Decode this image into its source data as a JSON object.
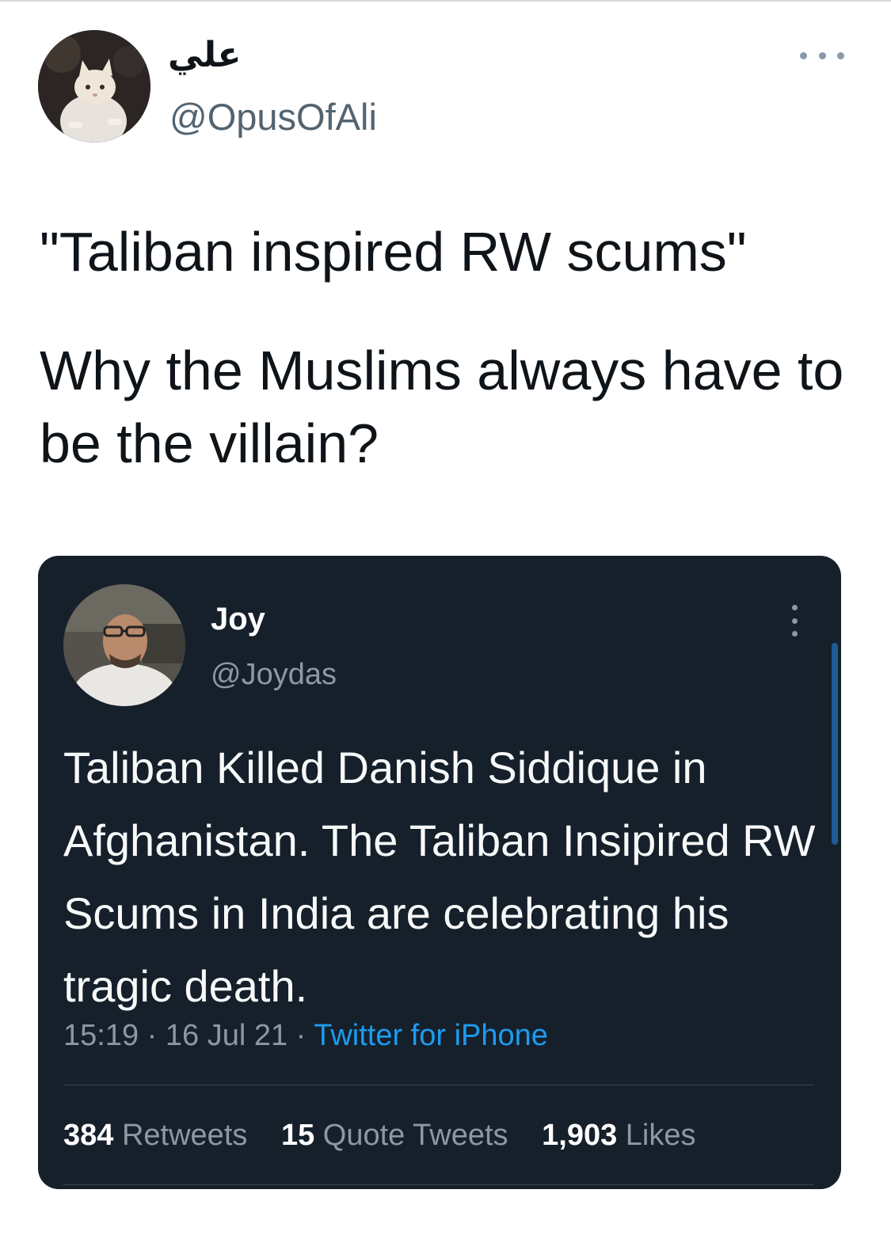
{
  "tweet": {
    "author": {
      "display_name": "علي",
      "handle": "@OpusOfAli",
      "avatar_icon": "cat-avatar-icon"
    },
    "menu_icon": "more-horizontal-icon",
    "text_lines": [
      "\"Taliban inspired RW scums\"",
      "Why the Muslims always have to be the villain?"
    ]
  },
  "quoted_tweet": {
    "author": {
      "display_name": "Joy",
      "handle": "@Joydas",
      "avatar_icon": "person-avatar-icon"
    },
    "menu_icon": "more-vertical-icon",
    "text": "Taliban Killed Danish Siddique in Afghanistan. The Taliban Insipired RW Scums in India are celebrating his tragic death.",
    "meta": {
      "time": "15:19",
      "separator": "·",
      "date": "16 Jul 21",
      "source": "Twitter for iPhone"
    },
    "stats": {
      "retweets_count": "384",
      "retweets_label": "Retweets",
      "quote_tweets_count": "15",
      "quote_tweets_label": "Quote Tweets",
      "likes_count": "1,903",
      "likes_label": "Likes"
    }
  },
  "colors": {
    "card_background": "#15202b",
    "link_blue": "#1d9bf0",
    "secondary_text": "#8b98a5",
    "handle_gray": "#536471"
  }
}
